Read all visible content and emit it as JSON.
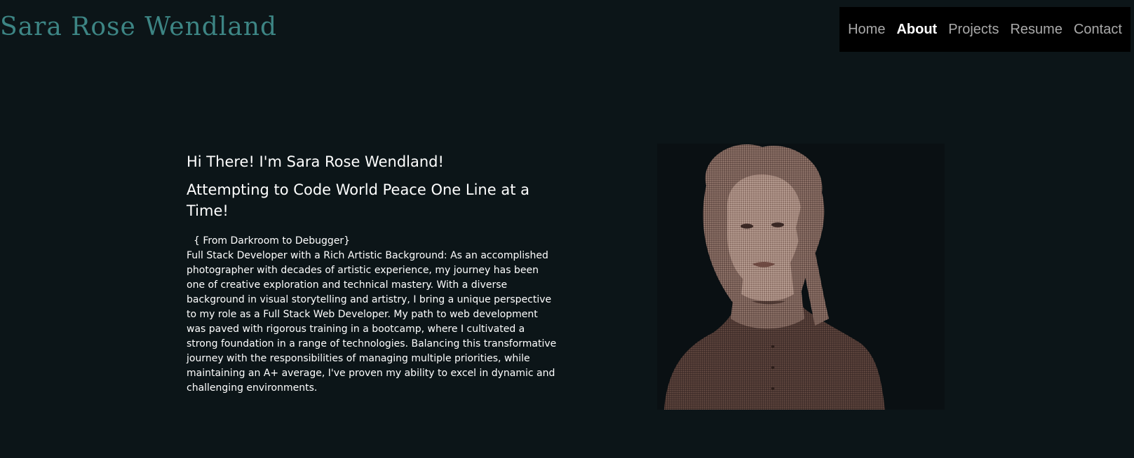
{
  "site": {
    "title": "Sara Rose Wendland",
    "title_color": "#3d8584",
    "background": "#0c1518"
  },
  "nav": {
    "items": [
      {
        "label": "Home",
        "active": false
      },
      {
        "label": "About",
        "active": true
      },
      {
        "label": "Projects",
        "active": false
      },
      {
        "label": "Resume",
        "active": false
      },
      {
        "label": "Contact",
        "active": false
      }
    ]
  },
  "about": {
    "greeting": "Hi There! I'm Sara Rose Wendland!",
    "tagline": "Attempting to Code World Peace One Line at a Time!",
    "subheading": "{ From Darkroom to Debugger}",
    "bio": "Full Stack Developer with a Rich Artistic Background: As an accomplished photographer with decades of artistic experience, my journey has been one of creative exploration and technical mastery. With a diverse background in visual storytelling and artistry, I bring a unique perspective to my role as a Full Stack Web Developer. My path to web development was paved with rigorous training in a bootcamp, where I cultivated a strong foundation in a range of technologies. Balancing this transformative journey with the responsibilities of managing multiple priorities, while maintaining an A+ average, I've proven my ability to excel in dynamic and challenging environments."
  },
  "portrait": {
    "tint": "#8a6a5e"
  }
}
